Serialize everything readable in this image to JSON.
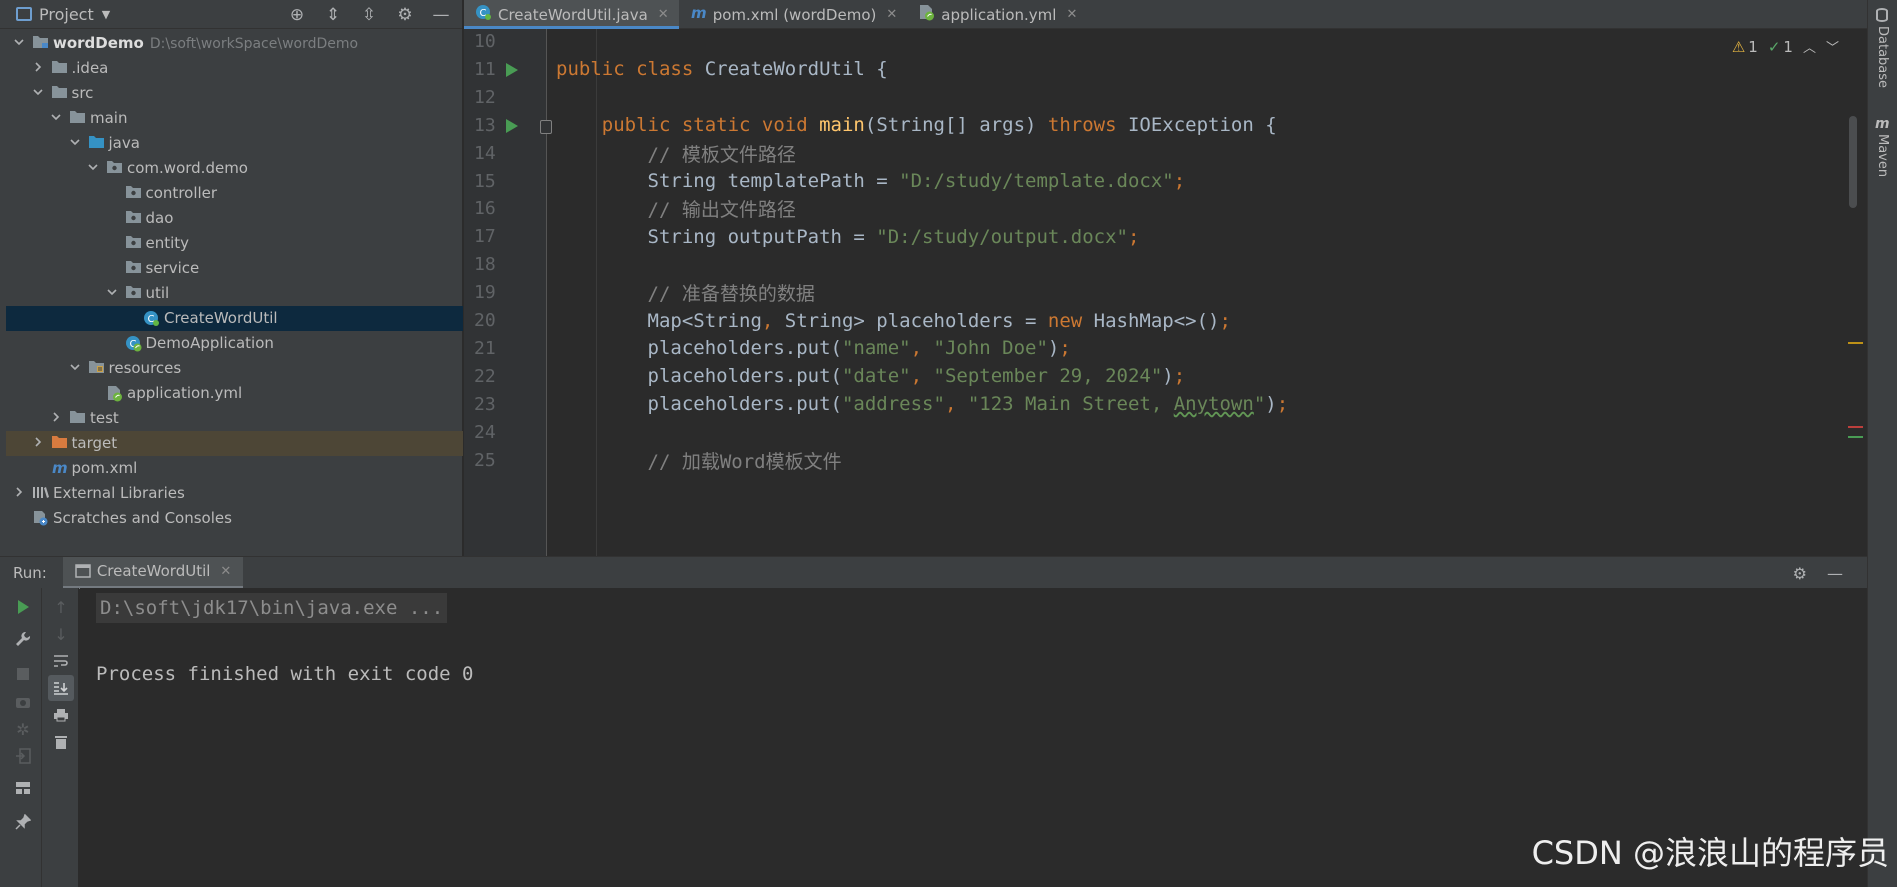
{
  "project_panel": {
    "title": "Project",
    "tree": [
      {
        "label": "wordDemo",
        "path": "D:\\soft\\workSpace\\wordDemo",
        "indent": 0,
        "arrow": "down",
        "icon": "module",
        "bold": true
      },
      {
        "label": ".idea",
        "indent": 1,
        "arrow": "right",
        "icon": "folder"
      },
      {
        "label": "src",
        "indent": 1,
        "arrow": "down",
        "icon": "folder"
      },
      {
        "label": "main",
        "indent": 2,
        "arrow": "down",
        "icon": "folder"
      },
      {
        "label": "java",
        "indent": 3,
        "arrow": "down",
        "icon": "source-folder"
      },
      {
        "label": "com.word.demo",
        "indent": 4,
        "arrow": "down",
        "icon": "package"
      },
      {
        "label": "controller",
        "indent": 5,
        "arrow": "none",
        "icon": "package"
      },
      {
        "label": "dao",
        "indent": 5,
        "arrow": "none",
        "icon": "package"
      },
      {
        "label": "entity",
        "indent": 5,
        "arrow": "none",
        "icon": "package"
      },
      {
        "label": "service",
        "indent": 5,
        "arrow": "none",
        "icon": "package"
      },
      {
        "label": "util",
        "indent": 5,
        "arrow": "down",
        "icon": "package"
      },
      {
        "label": "CreateWordUtil",
        "indent": 6,
        "arrow": "none",
        "icon": "java-class",
        "selected": true
      },
      {
        "label": "DemoApplication",
        "indent": 5,
        "arrow": "none",
        "icon": "spring-class"
      },
      {
        "label": "resources",
        "indent": 3,
        "arrow": "down",
        "icon": "resources-folder"
      },
      {
        "label": "application.yml",
        "indent": 4,
        "arrow": "none",
        "icon": "spring-yml"
      },
      {
        "label": "test",
        "indent": 2,
        "arrow": "right",
        "icon": "folder"
      },
      {
        "label": "target",
        "indent": 1,
        "arrow": "right",
        "icon": "excluded-folder",
        "excluded": true
      },
      {
        "label": "pom.xml",
        "indent": 1,
        "arrow": "none",
        "icon": "maven"
      },
      {
        "label": "External Libraries",
        "indent": 0,
        "arrow": "right",
        "icon": "libraries"
      },
      {
        "label": "Scratches and Consoles",
        "indent": 0,
        "arrow": "none",
        "icon": "scratches"
      }
    ]
  },
  "editor_tabs": [
    {
      "label": "CreateWordUtil.java",
      "icon": "java-class",
      "active": true
    },
    {
      "label": "pom.xml (wordDemo)",
      "icon": "maven",
      "active": false
    },
    {
      "label": "application.yml",
      "icon": "spring-yml",
      "active": false
    }
  ],
  "inspections": {
    "warnings": "1",
    "ok": "1"
  },
  "code_lines": [
    {
      "n": "10",
      "html": "",
      "run": false,
      "fold": false
    },
    {
      "n": "11",
      "html": "<span class='kw'>public class </span>CreateWordUtil {",
      "run": true,
      "fold": false
    },
    {
      "n": "12",
      "html": "",
      "run": false,
      "fold": false
    },
    {
      "n": "13",
      "html": "    <span class='kw'>public static void </span><span class='fn'>main</span>(String[] args) <span class='kw'>throws </span>IOException {",
      "run": true,
      "fold": true
    },
    {
      "n": "14",
      "html": "        <span class='cm'>// 模板文件路径</span>",
      "run": false,
      "fold": false
    },
    {
      "n": "15",
      "html": "        String templatePath = <span class='str'>\"D:/study/template.docx\"</span><span class='kw'>;</span>",
      "run": false,
      "fold": false
    },
    {
      "n": "16",
      "html": "        <span class='cm'>// 输出文件路径</span>",
      "run": false,
      "fold": false
    },
    {
      "n": "17",
      "html": "        String outputPath = <span class='str'>\"D:/study/output.docx\"</span><span class='kw'>;</span>",
      "run": false,
      "fold": false
    },
    {
      "n": "18",
      "html": "",
      "run": false,
      "fold": false
    },
    {
      "n": "19",
      "html": "        <span class='cm'>// 准备替换的数据</span>",
      "run": false,
      "fold": false
    },
    {
      "n": "20",
      "html": "        Map&lt;String<span class='kw'>, </span>String&gt; placeholders = <span class='kw'>new </span>HashMap&lt;&gt;()<span class='kw'>;</span>",
      "run": false,
      "fold": false
    },
    {
      "n": "21",
      "html": "        placeholders.put(<span class='str'>\"name\"</span><span class='kw'>, </span><span class='str'>\"John Doe\"</span>)<span class='kw'>;</span>",
      "run": false,
      "fold": false
    },
    {
      "n": "22",
      "html": "        placeholders.put(<span class='str'>\"date\"</span><span class='kw'>, </span><span class='str'>\"September 29, 2024\"</span>)<span class='kw'>;</span>",
      "run": false,
      "fold": false
    },
    {
      "n": "23",
      "html": "        placeholders.put(<span class='str'>\"address\"</span><span class='kw'>, </span><span class='str'>\"123 Main Street, <span class='wavy'>Anytown</span>\"</span>)<span class='kw'>;</span>",
      "run": false,
      "fold": false
    },
    {
      "n": "24",
      "html": "",
      "run": false,
      "fold": false
    },
    {
      "n": "25",
      "html": "        <span class='cm'>// 加载Word模板文件</span>",
      "run": false,
      "fold": false
    }
  ],
  "right_strip": {
    "database": "Database",
    "maven": "Maven"
  },
  "run_panel": {
    "label": "Run:",
    "tab": "CreateWordUtil",
    "console_cmd": "D:\\soft\\jdk17\\bin\\java.exe ...",
    "console_exit": "Process finished with exit code 0"
  },
  "watermark": "CSDN @浪浪山的程序员",
  "colors": {
    "accent": "#4a88c7",
    "keyword": "#cc7832",
    "string": "#6a8759",
    "comment": "#808080",
    "function": "#ffc66d",
    "run_green": "#499c54"
  }
}
